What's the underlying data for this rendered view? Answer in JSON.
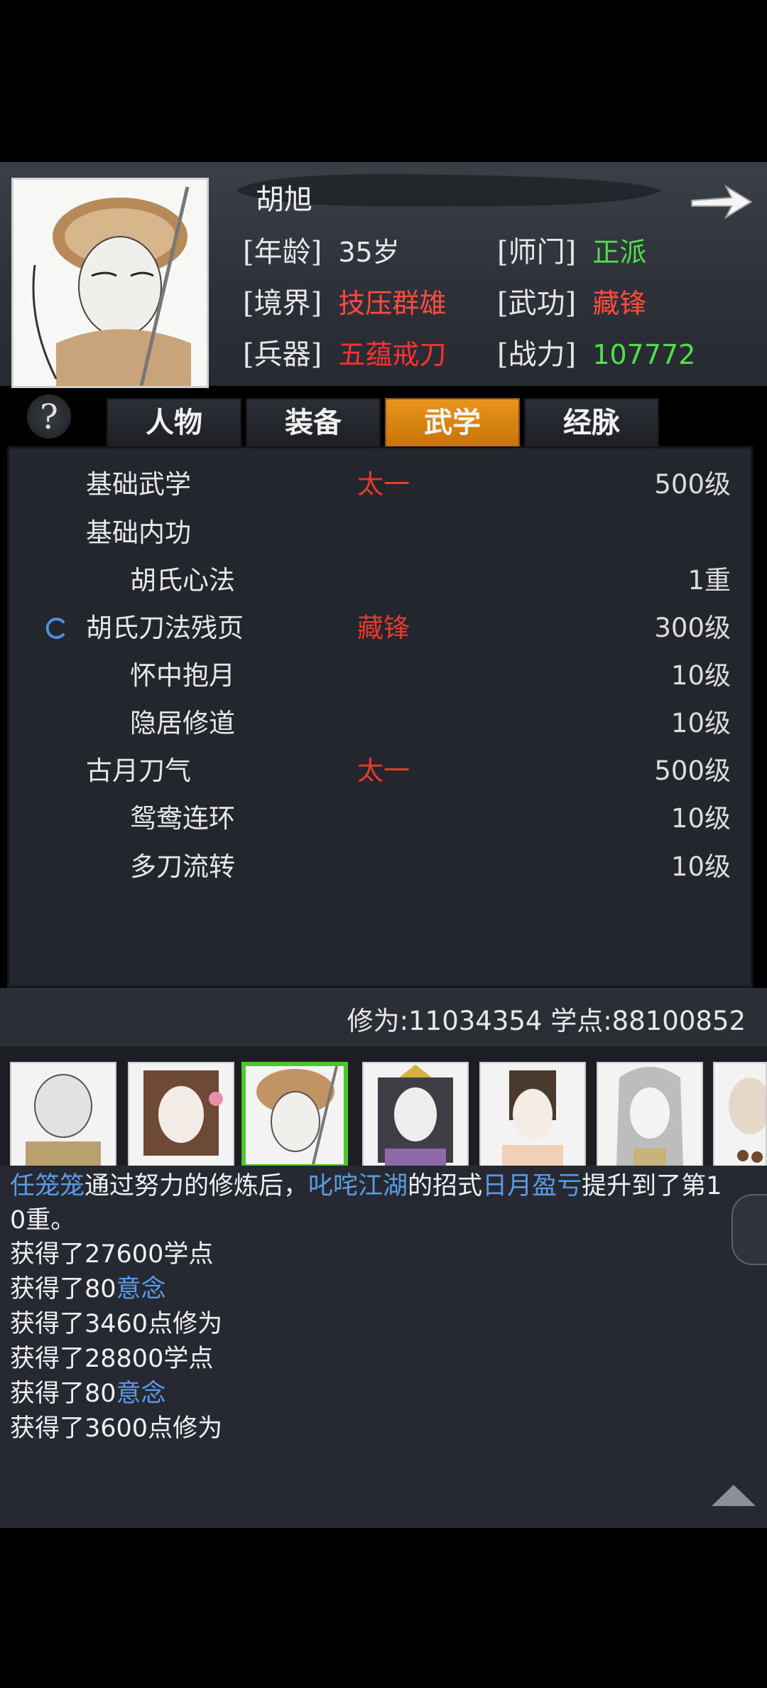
{
  "character": {
    "name": "胡旭",
    "stats": [
      {
        "label": "[年龄]",
        "value": "35岁",
        "color": "#e8e8e8"
      },
      {
        "label": "[师门]",
        "value": "正派",
        "color": "#4fe04a"
      },
      {
        "label": "[境界]",
        "value": "技压群雄",
        "color": "#ff4a3d"
      },
      {
        "label": "[武功]",
        "value": "藏锋",
        "color": "#ff4a3d"
      },
      {
        "label": "[兵器]",
        "value": "五蕴戒刀",
        "color": "#ff3030"
      },
      {
        "label": "[战力]",
        "value": "107772",
        "color": "#4fe04a"
      }
    ]
  },
  "tabs": [
    "人物",
    "装备",
    "武学",
    "经脉"
  ],
  "active_tab": "武学",
  "skills": [
    {
      "name": "基础武学",
      "tier": "太一",
      "level": "500级",
      "indent": false,
      "loading": false
    },
    {
      "name": "基础内功",
      "tier": "",
      "level": "",
      "indent": false,
      "loading": false
    },
    {
      "name": "胡氏心法",
      "tier": "",
      "level": "1重",
      "indent": true,
      "loading": false
    },
    {
      "name": "胡氏刀法残页",
      "tier": "藏锋",
      "level": "300级",
      "indent": false,
      "loading": true
    },
    {
      "name": "怀中抱月",
      "tier": "",
      "level": "10级",
      "indent": true,
      "loading": false
    },
    {
      "name": "隐居修道",
      "tier": "",
      "level": "10级",
      "indent": true,
      "loading": false
    },
    {
      "name": "古月刀气",
      "tier": "太一",
      "level": "500级",
      "indent": false,
      "loading": false
    },
    {
      "name": "鸳鸯连环",
      "tier": "",
      "level": "10级",
      "indent": true,
      "loading": false
    },
    {
      "name": "多刀流转",
      "tier": "",
      "level": "10级",
      "indent": true,
      "loading": false
    }
  ],
  "summary": "修为:11034354  学点:88100852",
  "log": {
    "line1": {
      "a": "任笼笼",
      "b": "通过努力的修炼后，",
      "c": "叱咤江湖",
      "d": "的招式",
      "e": "日月盈亏",
      "f": "提升到了第1"
    },
    "line2": "0重。",
    "lines": [
      {
        "text": "获得了27600学点",
        "hl": ""
      },
      {
        "text": "获得了80",
        "hl": "意念"
      },
      {
        "text": "获得了3460点修为",
        "hl": ""
      },
      {
        "text": "获得了28800学点",
        "hl": ""
      },
      {
        "text": "获得了80",
        "hl": "意念"
      },
      {
        "text": "获得了3600点修为",
        "hl": ""
      }
    ]
  }
}
